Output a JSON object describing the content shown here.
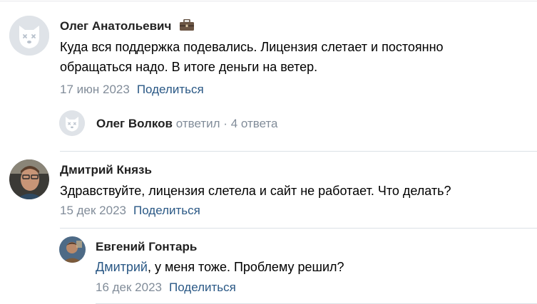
{
  "comments": [
    {
      "author": "Олег Анатольевич",
      "badge_icon": "briefcase-icon",
      "text_line1": "Куда вся поддержка подевались. Лицензия слетает и постоянно",
      "text_line2": "обращаться надо. В итоге деньги на ветер.",
      "date": "17 июн 2023",
      "share": "Поделиться",
      "reply_summary": {
        "author": "Олег Волков",
        "action": "ответил",
        "separator": "·",
        "count": "4 ответа"
      }
    },
    {
      "author": "Дмитрий Князь",
      "text": "Здравствуйте, лицензия слетела и сайт не работает. Что делать?",
      "date": "15 дек 2023",
      "share": "Поделиться",
      "replies": [
        {
          "author": "Евгений Гонтарь",
          "mention": "Дмитрий",
          "text": ", у меня тоже. Проблему решил?",
          "date": "16 дек 2023",
          "share": "Поделиться"
        }
      ]
    }
  ],
  "colors": {
    "link": "#2a5885",
    "meta": "#818c99",
    "divider": "#dce1e6"
  }
}
